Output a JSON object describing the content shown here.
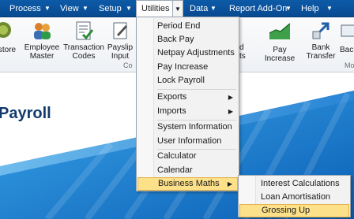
{
  "menubar": {
    "items": [
      {
        "label": "Process"
      },
      {
        "label": "View"
      },
      {
        "label": "Setup"
      },
      {
        "label": "Utilities"
      },
      {
        "label": "Data"
      },
      {
        "label": "Report Add-On"
      },
      {
        "label": "Help"
      }
    ]
  },
  "ribbon": {
    "buttons": [
      {
        "label": "store",
        "icon": "store-icon"
      },
      {
        "label": "Employee\nMaster",
        "icon": "employees-icon"
      },
      {
        "label": "Transaction\nCodes",
        "icon": "transaction-codes-icon"
      },
      {
        "label": "Payslip\nInput",
        "icon": "payslip-icon"
      },
      {
        "label": "d\nts",
        "icon": "partial-icon"
      },
      {
        "label": "Pay Increase",
        "icon": "pay-increase-icon"
      },
      {
        "label": "Bank\nTransfer",
        "icon": "bank-transfer-icon"
      },
      {
        "label": "Bac",
        "icon": "backup-icon"
      }
    ],
    "group_labels": [
      "Co",
      "Mo"
    ]
  },
  "page": {
    "title": "Payroll"
  },
  "utilities_menu": {
    "items": [
      {
        "label": "Period End"
      },
      {
        "label": "Back Pay"
      },
      {
        "label": "Netpay Adjustments"
      },
      {
        "label": "Pay Increase"
      },
      {
        "label": "Lock Payroll"
      },
      {
        "label": "Exports"
      },
      {
        "label": "Imports"
      },
      {
        "label": "System Information"
      },
      {
        "label": "User Information"
      },
      {
        "label": "Calculator"
      },
      {
        "label": "Calendar"
      },
      {
        "label": "Business Maths"
      }
    ]
  },
  "business_maths_menu": {
    "items": [
      {
        "label": "Interest Calculations"
      },
      {
        "label": "Loan Amortisation"
      },
      {
        "label": "Grossing Up Calculator"
      }
    ],
    "highlighted": "Grossing Up Calculator"
  },
  "colors": {
    "menubar": "#0b55a0",
    "highlight": "#fce08a",
    "title": "#123a6c",
    "body_blue": "#1a7fd0"
  }
}
